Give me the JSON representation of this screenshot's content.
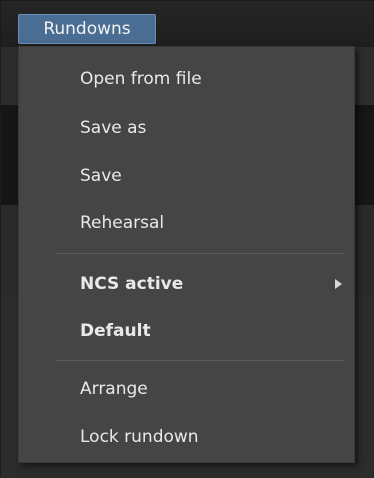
{
  "menubar": {
    "title": "Rundowns"
  },
  "menu": {
    "items": [
      {
        "label": "Open from file"
      },
      {
        "label": "Save as"
      },
      {
        "label": "Save"
      },
      {
        "label": "Rehearsal"
      },
      {
        "label": "NCS active"
      },
      {
        "label": "Default"
      },
      {
        "label": "Arrange"
      },
      {
        "label": "Lock rundown"
      }
    ],
    "submenu_arrow_icon": "triangle-right-icon"
  }
}
